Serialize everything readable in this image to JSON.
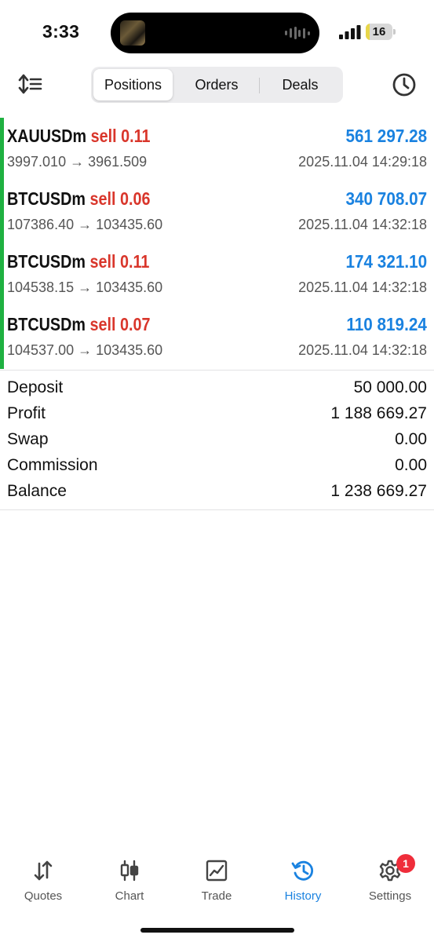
{
  "status_bar": {
    "time": "3:33",
    "battery": "16",
    "battery_level_percent": 16
  },
  "toolbar": {
    "tabs": [
      {
        "label": "Positions",
        "active": true
      },
      {
        "label": "Orders",
        "active": false
      },
      {
        "label": "Deals",
        "active": false
      }
    ]
  },
  "deals": [
    {
      "symbol": "XAUUSDm",
      "side": "sell 0.11",
      "profit": "561 297.28",
      "prices": "3997.010 → 3961.509",
      "time": "2025.11.04 14:29:18"
    },
    {
      "symbol": "BTCUSDm",
      "side": "sell 0.06",
      "profit": "340 708.07",
      "prices": "107386.40 → 103435.60",
      "time": "2025.11.04 14:32:18"
    },
    {
      "symbol": "BTCUSDm",
      "side": "sell 0.11",
      "profit": "174 321.10",
      "prices": "104538.15 → 103435.60",
      "time": "2025.11.04 14:32:18"
    },
    {
      "symbol": "BTCUSDm",
      "side": "sell 0.07",
      "profit": "110 819.24",
      "prices": "104537.00 → 103435.60",
      "time": "2025.11.04 14:32:18"
    }
  ],
  "summary": [
    {
      "label": "Deposit",
      "value": "50 000.00"
    },
    {
      "label": "Profit",
      "value": "1 188 669.27"
    },
    {
      "label": "Swap",
      "value": "0.00"
    },
    {
      "label": "Commission",
      "value": "0.00"
    },
    {
      "label": "Balance",
      "value": "1 238 669.27"
    }
  ],
  "tabbar": {
    "tabs": [
      {
        "label": "Quotes",
        "icon": "quotes-arrows-icon",
        "active": false
      },
      {
        "label": "Chart",
        "icon": "candlestick-icon",
        "active": false
      },
      {
        "label": "Trade",
        "icon": "trade-chart-icon",
        "active": false
      },
      {
        "label": "History",
        "icon": "history-icon",
        "active": true
      },
      {
        "label": "Settings",
        "icon": "gear-icon",
        "active": false
      }
    ],
    "settings_badge": "1"
  },
  "colors": {
    "accent_blue": "#1a82e0",
    "sell_red": "#d9362b",
    "profit_bar_green": "#1fb141",
    "badge_red": "#ef2d3a"
  }
}
